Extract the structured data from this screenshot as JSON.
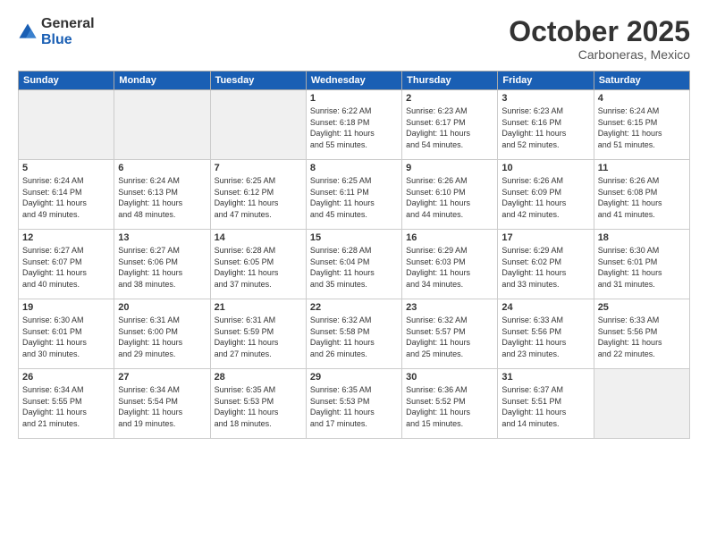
{
  "logo": {
    "general": "General",
    "blue": "Blue"
  },
  "header": {
    "month": "October 2025",
    "location": "Carboneras, Mexico"
  },
  "days": [
    "Sunday",
    "Monday",
    "Tuesday",
    "Wednesday",
    "Thursday",
    "Friday",
    "Saturday"
  ],
  "weeks": [
    [
      {
        "day": "",
        "info": ""
      },
      {
        "day": "",
        "info": ""
      },
      {
        "day": "",
        "info": ""
      },
      {
        "day": "1",
        "info": "Sunrise: 6:22 AM\nSunset: 6:18 PM\nDaylight: 11 hours\nand 55 minutes."
      },
      {
        "day": "2",
        "info": "Sunrise: 6:23 AM\nSunset: 6:17 PM\nDaylight: 11 hours\nand 54 minutes."
      },
      {
        "day": "3",
        "info": "Sunrise: 6:23 AM\nSunset: 6:16 PM\nDaylight: 11 hours\nand 52 minutes."
      },
      {
        "day": "4",
        "info": "Sunrise: 6:24 AM\nSunset: 6:15 PM\nDaylight: 11 hours\nand 51 minutes."
      }
    ],
    [
      {
        "day": "5",
        "info": "Sunrise: 6:24 AM\nSunset: 6:14 PM\nDaylight: 11 hours\nand 49 minutes."
      },
      {
        "day": "6",
        "info": "Sunrise: 6:24 AM\nSunset: 6:13 PM\nDaylight: 11 hours\nand 48 minutes."
      },
      {
        "day": "7",
        "info": "Sunrise: 6:25 AM\nSunset: 6:12 PM\nDaylight: 11 hours\nand 47 minutes."
      },
      {
        "day": "8",
        "info": "Sunrise: 6:25 AM\nSunset: 6:11 PM\nDaylight: 11 hours\nand 45 minutes."
      },
      {
        "day": "9",
        "info": "Sunrise: 6:26 AM\nSunset: 6:10 PM\nDaylight: 11 hours\nand 44 minutes."
      },
      {
        "day": "10",
        "info": "Sunrise: 6:26 AM\nSunset: 6:09 PM\nDaylight: 11 hours\nand 42 minutes."
      },
      {
        "day": "11",
        "info": "Sunrise: 6:26 AM\nSunset: 6:08 PM\nDaylight: 11 hours\nand 41 minutes."
      }
    ],
    [
      {
        "day": "12",
        "info": "Sunrise: 6:27 AM\nSunset: 6:07 PM\nDaylight: 11 hours\nand 40 minutes."
      },
      {
        "day": "13",
        "info": "Sunrise: 6:27 AM\nSunset: 6:06 PM\nDaylight: 11 hours\nand 38 minutes."
      },
      {
        "day": "14",
        "info": "Sunrise: 6:28 AM\nSunset: 6:05 PM\nDaylight: 11 hours\nand 37 minutes."
      },
      {
        "day": "15",
        "info": "Sunrise: 6:28 AM\nSunset: 6:04 PM\nDaylight: 11 hours\nand 35 minutes."
      },
      {
        "day": "16",
        "info": "Sunrise: 6:29 AM\nSunset: 6:03 PM\nDaylight: 11 hours\nand 34 minutes."
      },
      {
        "day": "17",
        "info": "Sunrise: 6:29 AM\nSunset: 6:02 PM\nDaylight: 11 hours\nand 33 minutes."
      },
      {
        "day": "18",
        "info": "Sunrise: 6:30 AM\nSunset: 6:01 PM\nDaylight: 11 hours\nand 31 minutes."
      }
    ],
    [
      {
        "day": "19",
        "info": "Sunrise: 6:30 AM\nSunset: 6:01 PM\nDaylight: 11 hours\nand 30 minutes."
      },
      {
        "day": "20",
        "info": "Sunrise: 6:31 AM\nSunset: 6:00 PM\nDaylight: 11 hours\nand 29 minutes."
      },
      {
        "day": "21",
        "info": "Sunrise: 6:31 AM\nSunset: 5:59 PM\nDaylight: 11 hours\nand 27 minutes."
      },
      {
        "day": "22",
        "info": "Sunrise: 6:32 AM\nSunset: 5:58 PM\nDaylight: 11 hours\nand 26 minutes."
      },
      {
        "day": "23",
        "info": "Sunrise: 6:32 AM\nSunset: 5:57 PM\nDaylight: 11 hours\nand 25 minutes."
      },
      {
        "day": "24",
        "info": "Sunrise: 6:33 AM\nSunset: 5:56 PM\nDaylight: 11 hours\nand 23 minutes."
      },
      {
        "day": "25",
        "info": "Sunrise: 6:33 AM\nSunset: 5:56 PM\nDaylight: 11 hours\nand 22 minutes."
      }
    ],
    [
      {
        "day": "26",
        "info": "Sunrise: 6:34 AM\nSunset: 5:55 PM\nDaylight: 11 hours\nand 21 minutes."
      },
      {
        "day": "27",
        "info": "Sunrise: 6:34 AM\nSunset: 5:54 PM\nDaylight: 11 hours\nand 19 minutes."
      },
      {
        "day": "28",
        "info": "Sunrise: 6:35 AM\nSunset: 5:53 PM\nDaylight: 11 hours\nand 18 minutes."
      },
      {
        "day": "29",
        "info": "Sunrise: 6:35 AM\nSunset: 5:53 PM\nDaylight: 11 hours\nand 17 minutes."
      },
      {
        "day": "30",
        "info": "Sunrise: 6:36 AM\nSunset: 5:52 PM\nDaylight: 11 hours\nand 15 minutes."
      },
      {
        "day": "31",
        "info": "Sunrise: 6:37 AM\nSunset: 5:51 PM\nDaylight: 11 hours\nand 14 minutes."
      },
      {
        "day": "",
        "info": ""
      }
    ]
  ]
}
